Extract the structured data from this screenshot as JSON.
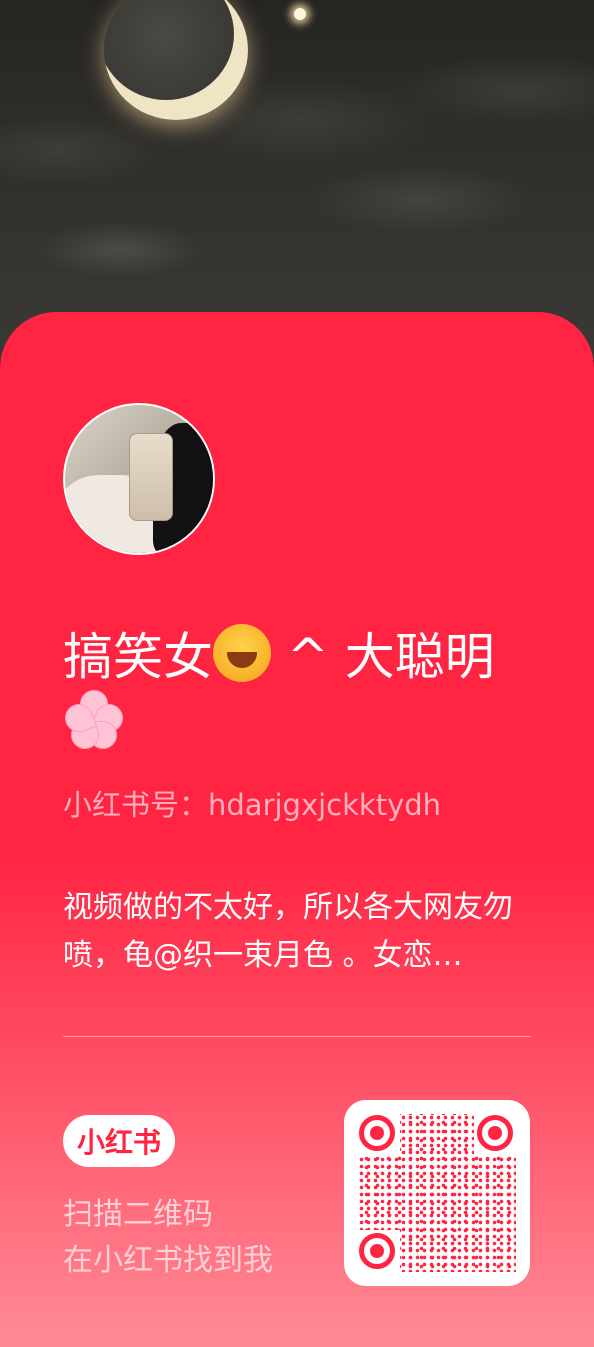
{
  "profile": {
    "name": "搞笑女",
    "name_suffix": "^ 大聪明",
    "id_label": "小红书号：",
    "id_value": "hdarjgxjckktydh",
    "bio": "视频做的不太好，所以各大网友勿喷，龟@织一束月色 。女恋…"
  },
  "footer": {
    "brand": "小红书",
    "scan_line1": "扫描二维码",
    "scan_line2": "在小红书找到我"
  },
  "colors": {
    "brand_red": "#ff2442",
    "card_bottom": "#ff8a96"
  }
}
